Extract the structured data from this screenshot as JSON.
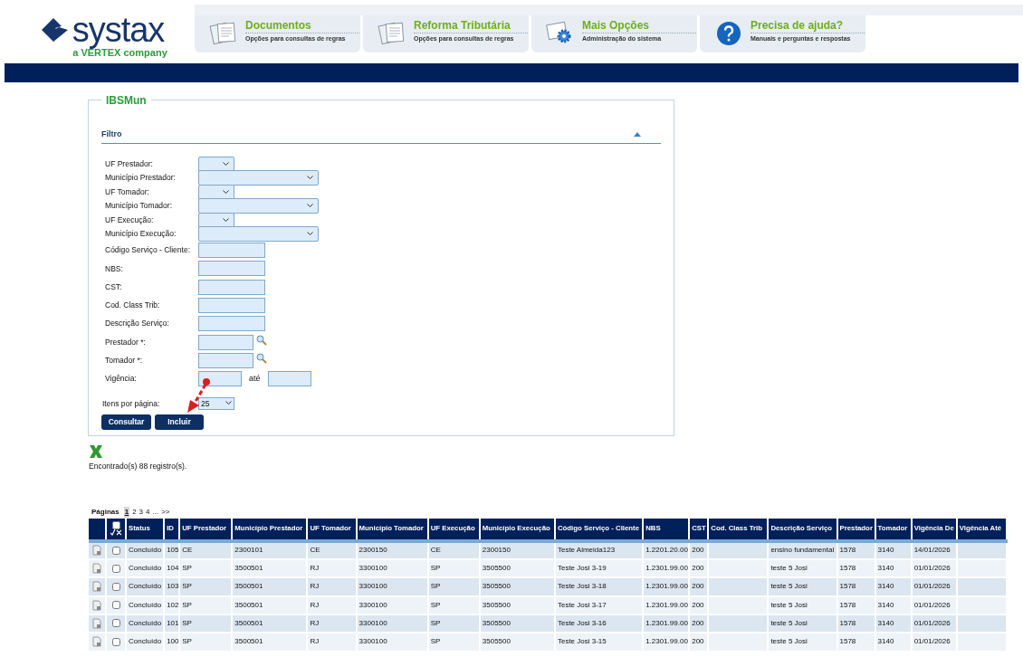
{
  "logo": {
    "name": "systax",
    "tagline": "a VERTEX company"
  },
  "nav": [
    {
      "title": "Documentos",
      "subtitle": "Opções para consultas de regras",
      "kind": "documents"
    },
    {
      "title": "Reforma Tributária",
      "subtitle": "Opções para consultas de regras",
      "kind": "documents"
    },
    {
      "title": "Mais Opções",
      "subtitle": "Administração do sistema",
      "kind": "gear"
    },
    {
      "title": "Precisa de ajuda?",
      "subtitle": "Manuais e perguntas e respostas",
      "kind": "help"
    }
  ],
  "panel": {
    "title": "IBSMun",
    "section": "Filtro",
    "expanded": true,
    "fields": [
      {
        "label": "UF Prestador:",
        "kind": "select-small"
      },
      {
        "label": "Município Prestador:",
        "kind": "select-wide"
      },
      {
        "label": "UF Tomador:",
        "kind": "select-small"
      },
      {
        "label": "Município Tomador:",
        "kind": "select-wide"
      },
      {
        "label": "UF Execução:",
        "kind": "select-small"
      },
      {
        "label": "Município Execução:",
        "kind": "select-wide"
      },
      {
        "label": "Código Serviço - Cliente:",
        "kind": "text"
      },
      {
        "label": "NBS:",
        "kind": "text"
      },
      {
        "label": "CST:",
        "kind": "text"
      },
      {
        "label": "Cod. Class Trib:",
        "kind": "text"
      },
      {
        "label": "Descrição Serviço:",
        "kind": "text"
      },
      {
        "label": "Prestador *:",
        "kind": "lookup"
      },
      {
        "label": "Tomador *:",
        "kind": "lookup"
      },
      {
        "label": "Vigência:",
        "kind": "range",
        "between": "até"
      }
    ],
    "items_per_page": {
      "label": "Itens por página:",
      "value": "25"
    },
    "buttons": [
      "Consultar",
      "Incluir"
    ]
  },
  "result": {
    "count_text": "Encontrado(s) 88 registro(s).",
    "pages_label": "Páginas",
    "pages": [
      {
        "label": "1",
        "selected": true
      },
      {
        "label": "2",
        "selected": false
      },
      {
        "label": "3",
        "selected": false
      },
      {
        "label": "4",
        "selected": false
      },
      {
        "label": "...",
        "selected": false
      },
      {
        "label": ">>",
        "selected": false
      }
    ]
  },
  "table": {
    "select_all_checked": false,
    "columns": [
      "Status",
      "ID",
      "UF Prestador",
      "Município Prestador",
      "UF Tomador",
      "Município Tomador",
      "UF Execução",
      "Município Execução",
      "Código Serviço - Cliente",
      "NBS",
      "CST",
      "Cod. Class Trib",
      "Descrição Serviço",
      "Prestador",
      "Tomador",
      "Vigência De",
      "Vigência Até"
    ],
    "rows": [
      {
        "checked": false,
        "cells": [
          "Concluído",
          "105",
          "CE",
          "2300101",
          "CE",
          "2300150",
          "CE",
          "2300150",
          "Teste Almeida123",
          "1.2201.20.00",
          "200",
          "",
          "ensino fundamental",
          "1578",
          "3140",
          "14/01/2026",
          ""
        ]
      },
      {
        "checked": false,
        "cells": [
          "Concluído",
          "104",
          "SP",
          "3500501",
          "RJ",
          "3300100",
          "SP",
          "3505500",
          "Teste Josi 3-19",
          "1.2301.99.00",
          "200",
          "",
          "teste 5 Josi",
          "1578",
          "3140",
          "01/01/2026",
          ""
        ]
      },
      {
        "checked": false,
        "cells": [
          "Concluído",
          "103",
          "SP",
          "3500501",
          "RJ",
          "3300100",
          "SP",
          "3505500",
          "Teste Josi 3-18",
          "1.2301.99.00",
          "200",
          "",
          "teste 5 Josi",
          "1578",
          "3140",
          "01/01/2026",
          ""
        ]
      },
      {
        "checked": false,
        "cells": [
          "Concluído",
          "102",
          "SP",
          "3500501",
          "RJ",
          "3300100",
          "SP",
          "3505500",
          "Teste Josi 3-17",
          "1.2301.99.00",
          "200",
          "",
          "teste 5 Josi",
          "1578",
          "3140",
          "01/01/2026",
          ""
        ]
      },
      {
        "checked": false,
        "cells": [
          "Concluído",
          "101",
          "SP",
          "3500501",
          "RJ",
          "3300100",
          "SP",
          "3505500",
          "Teste Josi 3-16",
          "1.2301.99.00",
          "200",
          "",
          "teste 5 Josi",
          "1578",
          "3140",
          "01/01/2026",
          ""
        ]
      },
      {
        "checked": false,
        "cells": [
          "Concluído",
          "100",
          "SP",
          "3500501",
          "RJ",
          "3300100",
          "SP",
          "3505500",
          "Teste Josi 3-15",
          "1.2301.99.00",
          "200",
          "",
          "teste 5 Josi",
          "1578",
          "3140",
          "01/01/2026",
          ""
        ]
      }
    ]
  }
}
